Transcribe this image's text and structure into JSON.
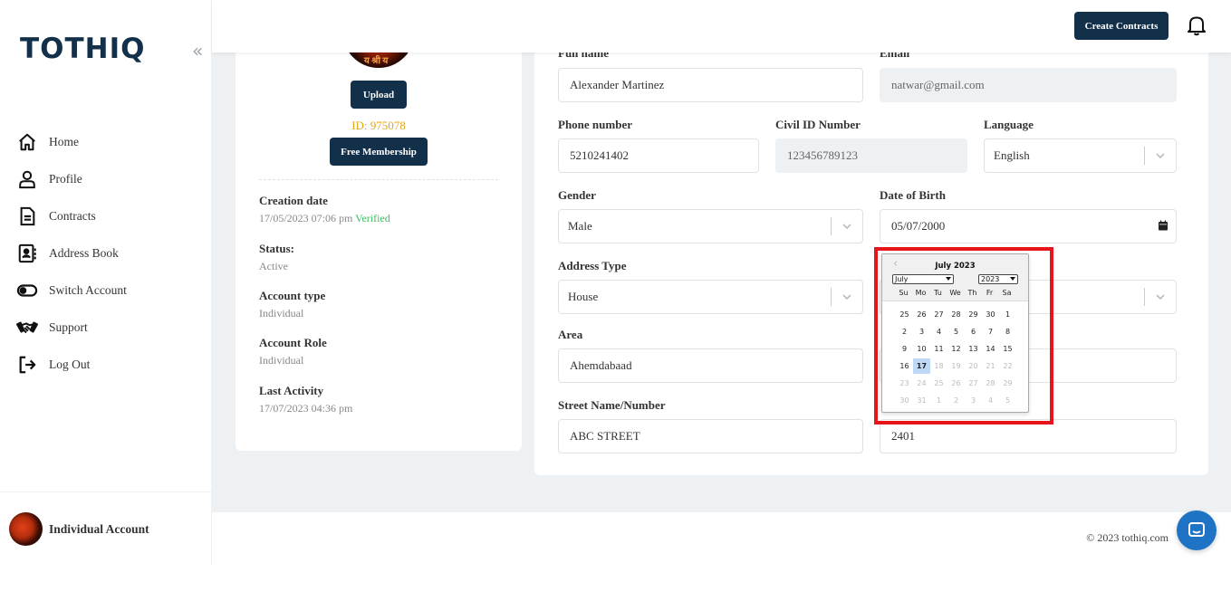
{
  "app": {
    "logo": "TOTHIQ",
    "collapse_icon": "«"
  },
  "sidebar": {
    "items": [
      {
        "label": "Home",
        "icon": "home-icon"
      },
      {
        "label": "Profile",
        "icon": "user-icon"
      },
      {
        "label": "Contracts",
        "icon": "document-icon"
      },
      {
        "label": "Address Book",
        "icon": "address-book-icon"
      },
      {
        "label": "Switch Account",
        "icon": "toggle-icon"
      },
      {
        "label": "Support",
        "icon": "handshake-icon"
      },
      {
        "label": "Log Out",
        "icon": "logout-icon"
      }
    ],
    "account_name": "Individual Account"
  },
  "header": {
    "create_label": "Create Contracts"
  },
  "profile": {
    "upload_label": "Upload",
    "id_text": "ID: 975078",
    "membership_label": "Free Membership",
    "creation_label": "Creation date",
    "creation_value": "17/05/2023 07:06 pm",
    "verified": "Verified",
    "status_label": "Status:",
    "status_value": "Active",
    "account_type_label": "Account type",
    "account_type_value": "Individual",
    "account_role_label": "Account Role",
    "account_role_value": "Individual",
    "last_activity_label": "Last Activity",
    "last_activity_value": "17/07/2023 04:36 pm"
  },
  "form": {
    "full_name_label": "Full name",
    "full_name": "Alexander Martinez",
    "email_label": "Email",
    "email": "natwar@gmail.com",
    "phone_label": "Phone number",
    "phone": "5210241402",
    "civil_label": "Civil ID Number",
    "civil": "123456789123",
    "language_label": "Language",
    "language": "English",
    "gender_label": "Gender",
    "gender": "Male",
    "dob_label": "Date of Birth",
    "dob": "05/07/2000",
    "address_type_label": "Address Type",
    "address_type": "House",
    "area_label": "Area",
    "area": "Ahemdabaad",
    "street_label": "Street Name/Number",
    "street": "ABC STREET",
    "building": "2401"
  },
  "datepicker": {
    "prev_icon": "‹",
    "title": "July 2023",
    "month_select": "July",
    "year_select": "2023",
    "days_of_week": [
      "Su",
      "Mo",
      "Tu",
      "We",
      "Th",
      "Fr",
      "Sa"
    ],
    "days": [
      {
        "d": "25",
        "s": ""
      },
      {
        "d": "26",
        "s": ""
      },
      {
        "d": "27",
        "s": ""
      },
      {
        "d": "28",
        "s": ""
      },
      {
        "d": "29",
        "s": ""
      },
      {
        "d": "30",
        "s": ""
      },
      {
        "d": "1",
        "s": ""
      },
      {
        "d": "2",
        "s": ""
      },
      {
        "d": "3",
        "s": ""
      },
      {
        "d": "4",
        "s": ""
      },
      {
        "d": "5",
        "s": ""
      },
      {
        "d": "6",
        "s": ""
      },
      {
        "d": "7",
        "s": ""
      },
      {
        "d": "8",
        "s": ""
      },
      {
        "d": "9",
        "s": ""
      },
      {
        "d": "10",
        "s": ""
      },
      {
        "d": "11",
        "s": ""
      },
      {
        "d": "12",
        "s": ""
      },
      {
        "d": "13",
        "s": ""
      },
      {
        "d": "14",
        "s": ""
      },
      {
        "d": "15",
        "s": ""
      },
      {
        "d": "16",
        "s": ""
      },
      {
        "d": "17",
        "s": "sel"
      },
      {
        "d": "18",
        "s": "out"
      },
      {
        "d": "19",
        "s": "out"
      },
      {
        "d": "20",
        "s": "out"
      },
      {
        "d": "21",
        "s": "out"
      },
      {
        "d": "22",
        "s": "out"
      },
      {
        "d": "23",
        "s": "out"
      },
      {
        "d": "24",
        "s": "out"
      },
      {
        "d": "25",
        "s": "out"
      },
      {
        "d": "26",
        "s": "out"
      },
      {
        "d": "27",
        "s": "out"
      },
      {
        "d": "28",
        "s": "out"
      },
      {
        "d": "29",
        "s": "out"
      },
      {
        "d": "30",
        "s": "out"
      },
      {
        "d": "31",
        "s": "out"
      },
      {
        "d": "1",
        "s": "out"
      },
      {
        "d": "2",
        "s": "out"
      },
      {
        "d": "3",
        "s": "out"
      },
      {
        "d": "4",
        "s": "out"
      },
      {
        "d": "5",
        "s": "out"
      }
    ]
  },
  "footer": {
    "copyright": "© 2023 tothiq.com"
  },
  "colors": {
    "brand": "#13304a",
    "accent_blue": "#1f73c4",
    "verified": "#3bbf5e",
    "id": "#e0a81a",
    "highlight": "#e8141c"
  }
}
